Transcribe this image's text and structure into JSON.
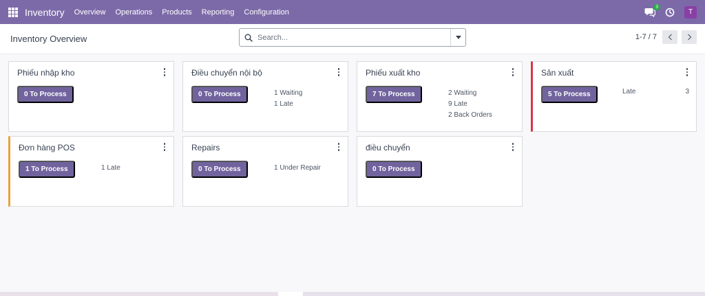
{
  "navbar": {
    "brand": "Inventory",
    "menu": [
      "Overview",
      "Operations",
      "Products",
      "Reporting",
      "Configuration"
    ],
    "chat_count": "3",
    "avatar_initial": "T"
  },
  "control": {
    "title": "Inventory Overview",
    "search_placeholder": "Search...",
    "pager": "1-7 / 7"
  },
  "cards": [
    {
      "title": "Phiếu nhập kho",
      "button": "0 To Process",
      "stats": []
    },
    {
      "title": "Điều chuyển nội bộ",
      "button": "0 To Process",
      "stats": [
        "1 Waiting",
        "1 Late"
      ]
    },
    {
      "title": "Phiếu xuất kho",
      "button": "7 To Process",
      "stats": [
        "2 Waiting",
        "9 Late",
        "2 Back Orders"
      ]
    },
    {
      "title": "Sản xuất",
      "button": "5 To Process",
      "late_label": "Late",
      "late_count": "3",
      "accent": "#dc3545"
    },
    {
      "title": "Đơn hàng POS",
      "button": "1 To Process",
      "stats": [
        "1 Late"
      ],
      "accent": "#e8a33d"
    },
    {
      "title": "Repairs",
      "button": "0 To Process",
      "stats": [
        "1 Under Repair"
      ]
    },
    {
      "title": "điều chuyển",
      "button": "0 To Process",
      "stats": []
    }
  ],
  "colors": {
    "navbar": "#7c6aa8",
    "button": "#71639e",
    "accent_red": "#dc3545",
    "accent_orange": "#e8a33d"
  }
}
